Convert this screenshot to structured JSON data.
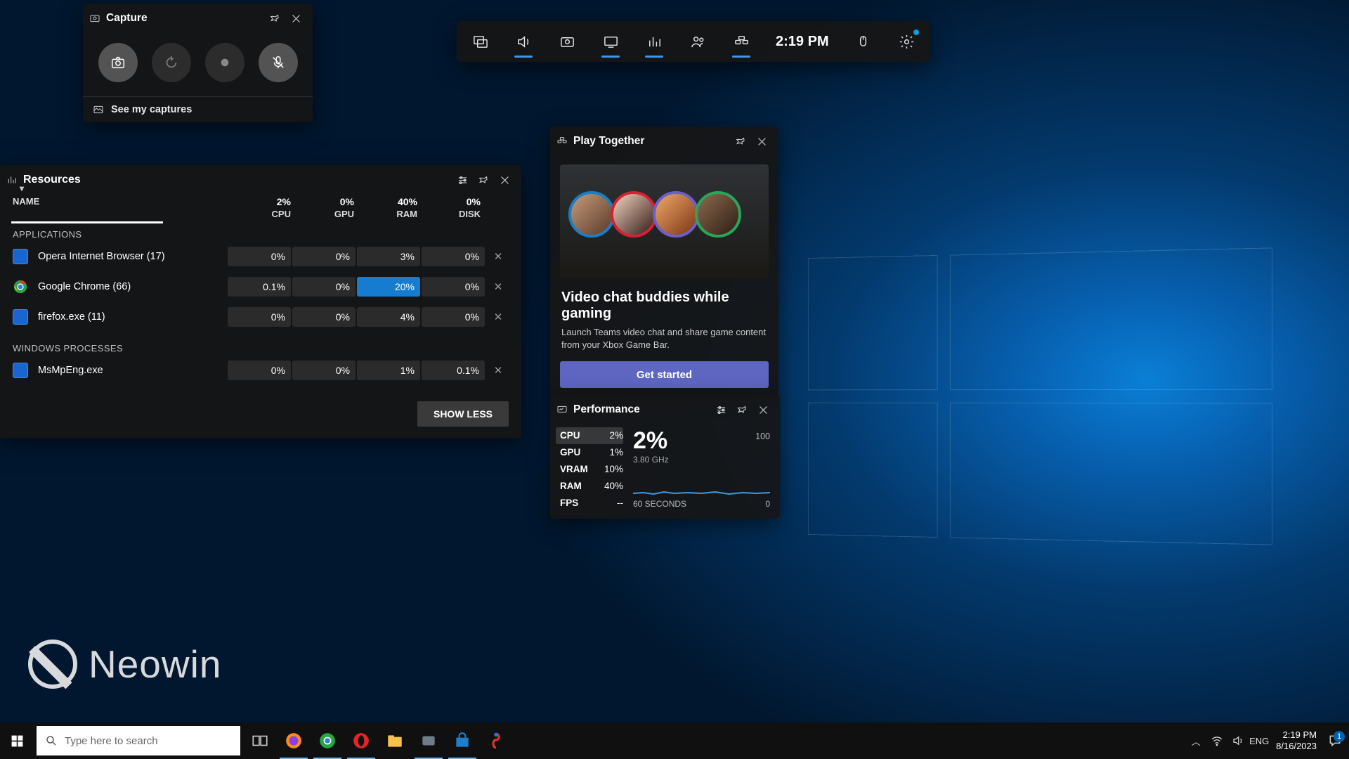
{
  "topbar": {
    "time": "2:19 PM"
  },
  "capture": {
    "title": "Capture",
    "link": "See my captures"
  },
  "resources": {
    "title": "Resources",
    "headers": {
      "name": "NAME",
      "cpu": "CPU",
      "gpu": "GPU",
      "ram": "RAM",
      "disk": "DISK"
    },
    "totals": {
      "cpu": "2%",
      "gpu": "0%",
      "ram": "40%",
      "disk": "0%"
    },
    "sections": {
      "apps": "APPLICATIONS",
      "win": "WINDOWS PROCESSES"
    },
    "apps": [
      {
        "name": "Opera Internet Browser (17)",
        "cpu": "0%",
        "gpu": "0%",
        "ram": "3%",
        "disk": "0%",
        "icon": "#1a66d1"
      },
      {
        "name": "Google Chrome (66)",
        "cpu": "0.1%",
        "gpu": "0%",
        "ram": "20%",
        "ramHi": true,
        "disk": "0%",
        "icon": "chrome"
      },
      {
        "name": "firefox.exe (11)",
        "cpu": "0%",
        "gpu": "0%",
        "ram": "4%",
        "disk": "0%",
        "icon": "#1a66d1"
      }
    ],
    "win": [
      {
        "name": "MsMpEng.exe",
        "cpu": "0%",
        "gpu": "0%",
        "ram": "1%",
        "disk": "0.1%",
        "icon": "#1a66d1"
      }
    ],
    "showless": "SHOW LESS"
  },
  "play": {
    "title": "Play Together",
    "headline": "Video chat buddies while gaming",
    "desc": "Launch Teams video chat and share game content from your Xbox Game Bar.",
    "button": "Get started"
  },
  "perf": {
    "title": "Performance",
    "stats": [
      {
        "k": "CPU",
        "v": "2%",
        "on": true
      },
      {
        "k": "GPU",
        "v": "1%"
      },
      {
        "k": "VRAM",
        "v": "10%"
      },
      {
        "k": "RAM",
        "v": "40%"
      },
      {
        "k": "FPS",
        "v": "--"
      }
    ],
    "big": "2%",
    "freq": "3.80 GHz",
    "ymax": "100",
    "xlabel": "60 SECONDS",
    "xzero": "0"
  },
  "taskbar": {
    "search": "Type here to search",
    "lang": "ENG",
    "time": "2:19 PM",
    "date": "8/16/2023",
    "notif": "1"
  },
  "watermark": "Neowin"
}
